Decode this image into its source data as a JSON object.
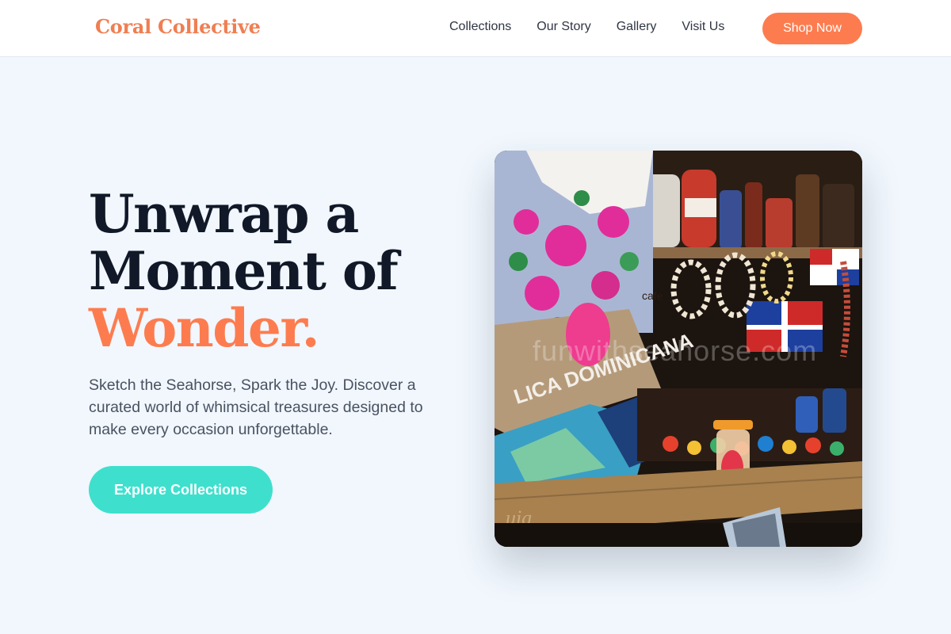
{
  "header": {
    "brand": "Coral Collective",
    "nav": [
      "Collections",
      "Our Story",
      "Gallery",
      "Visit Us"
    ],
    "cta": "Shop Now"
  },
  "hero": {
    "title_line1": "Unwrap a",
    "title_line2": "Moment of",
    "title_accent": "Wonder.",
    "subtitle": "Sketch the Seahorse, Spark the Joy. Discover a curated world of whimsical treasures designed to make every occasion unforgettable.",
    "button": "Explore Collections",
    "image_alt": "Colorful souvenir market stall with printed sarongs, shell necklaces, flags and bottles",
    "image_text": {
      "watermark": "funwithseahorse.com",
      "sign": "LICA DOMINICANA",
      "label_brown": "cafe"
    }
  },
  "colors": {
    "accent": "#fd7c4f",
    "teal": "#3ee0cd",
    "background": "#f1f7fd",
    "heading": "#111827"
  }
}
